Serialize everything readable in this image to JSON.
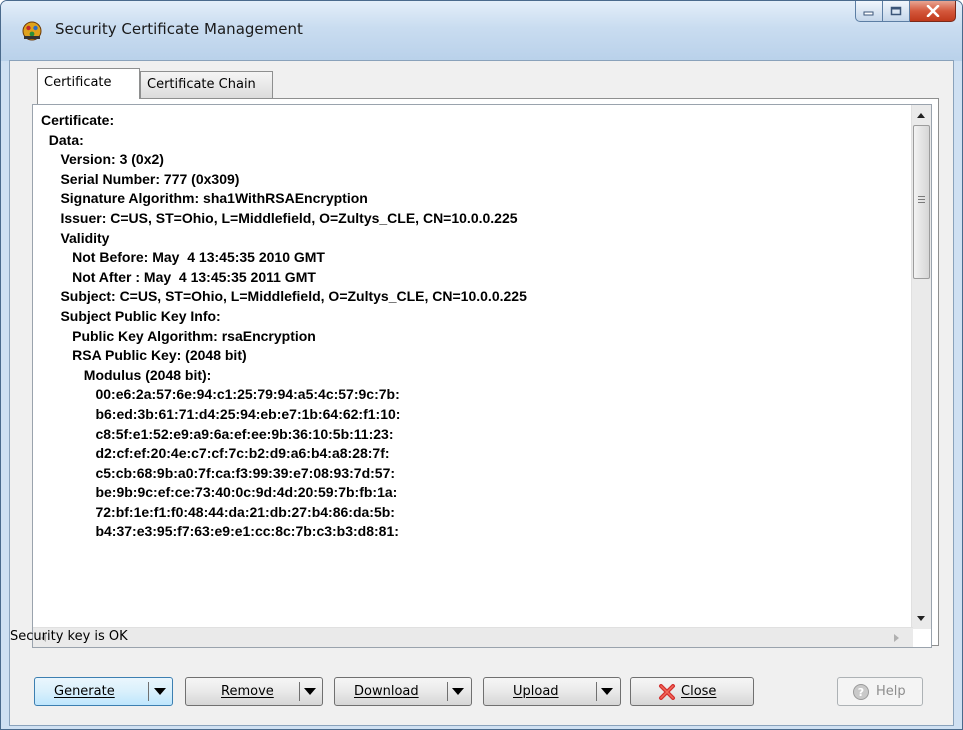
{
  "window": {
    "title": "Security Certificate Management"
  },
  "tabs": [
    {
      "label": "Certificate",
      "active": true
    },
    {
      "label": "Certificate Chain",
      "active": false
    }
  ],
  "certificate_lines": [
    "Certificate:",
    "  Data:",
    "     Version: 3 (0x2)",
    "     Serial Number: 777 (0x309)",
    "     Signature Algorithm: sha1WithRSAEncryption",
    "     Issuer: C=US, ST=Ohio, L=Middlefield, O=Zultys_CLE, CN=10.0.0.225",
    "     Validity",
    "        Not Before: May  4 13:45:35 2010 GMT",
    "        Not After : May  4 13:45:35 2011 GMT",
    "     Subject: C=US, ST=Ohio, L=Middlefield, O=Zultys_CLE, CN=10.0.0.225",
    "     Subject Public Key Info:",
    "        Public Key Algorithm: rsaEncryption",
    "        RSA Public Key: (2048 bit)",
    "           Modulus (2048 bit):",
    "              00:e6:2a:57:6e:94:c1:25:79:94:a5:4c:57:9c:7b:",
    "              b6:ed:3b:61:71:d4:25:94:eb:e7:1b:64:62:f1:10:",
    "              c8:5f:e1:52:e9:a9:6a:ef:ee:9b:36:10:5b:11:23:",
    "              d2:cf:ef:20:4e:c7:cf:7c:b2:d9:a6:b4:a8:28:7f:",
    "              c5:cb:68:9b:a0:7f:ca:f3:99:39:e7:08:93:7d:57:",
    "              be:9b:9c:ef:ce:73:40:0c:9d:4d:20:59:7b:fb:1a:",
    "              72:bf:1e:f1:f0:48:44:da:21:db:27:b4:86:da:5b:",
    "              b4:37:e3:95:f7:63:e9:e1:cc:8c:7b:c3:b3:d8:81:"
  ],
  "status": {
    "text": "Security key is OK"
  },
  "buttons": {
    "generate": "Generate",
    "remove": "Remove",
    "download": "Download",
    "upload": "Upload",
    "close": "Close",
    "help": "Help"
  },
  "colors": {
    "frame": "#cfe0f2",
    "dialog_bg": "#f0f0f0",
    "close_red": "#c0391b",
    "focus_blue": "#3c7fb1"
  },
  "icons": {
    "app": "certificate-app-icon",
    "close_button": "red-x-icon",
    "help_button": "help-question-icon"
  }
}
